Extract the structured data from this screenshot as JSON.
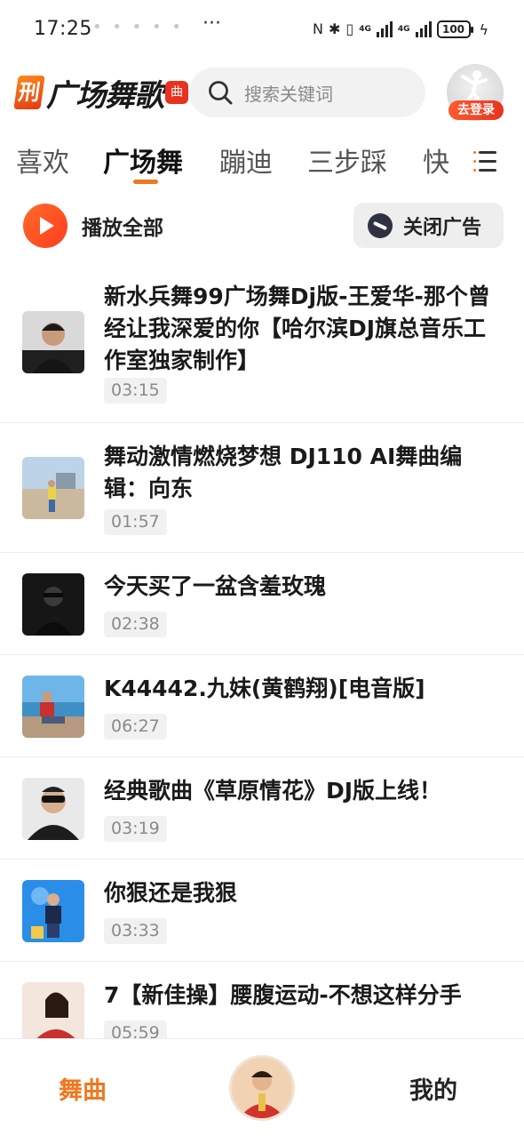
{
  "status_bar": {
    "time": "17:25",
    "dots": "• • • • •",
    "more": "···",
    "nfc": "N",
    "bluetooth": "✱",
    "vibrate": "▯",
    "net1": "4G",
    "net2": "4G",
    "battery": "100",
    "charging": "ϟ"
  },
  "header": {
    "logo_mark": "刑",
    "logo_text": "广场舞歌",
    "logo_badge": "曲",
    "search_placeholder": "搜索关键词",
    "login_badge": "去登录"
  },
  "tabs": [
    "喜欢",
    "广场舞",
    "蹦迪",
    "三步踩",
    "快"
  ],
  "active_tab_index": 1,
  "actions": {
    "play_all": "播放全部",
    "close_ad": "关闭广告"
  },
  "songs": [
    {
      "title": "新水兵舞99广场舞Dj版-王爱华-那个曾经让我深爱的你【哈尔滨DJ旗总音乐工作室独家制作】",
      "duration": "03:15"
    },
    {
      "title": "舞动激情燃烧梦想 DJ110  AI舞曲编辑：向东",
      "duration": "01:57"
    },
    {
      "title": "今天买了一盆含羞玫瑰",
      "duration": "02:38"
    },
    {
      "title": "K44442.九妹(黄鹤翔)[电音版]",
      "duration": "06:27"
    },
    {
      "title": "经典歌曲《草原情花》DJ版上线！",
      "duration": "03:19"
    },
    {
      "title": "你狠还是我狠",
      "duration": "03:33"
    },
    {
      "title": "7【新佳操】腰腹运动-不想这样分手",
      "duration": "05:59"
    }
  ],
  "bottom_nav": {
    "dance": "舞曲",
    "mine": "我的"
  },
  "colors": {
    "accent": "#f0781e",
    "play_red": "#ff3d1e"
  }
}
